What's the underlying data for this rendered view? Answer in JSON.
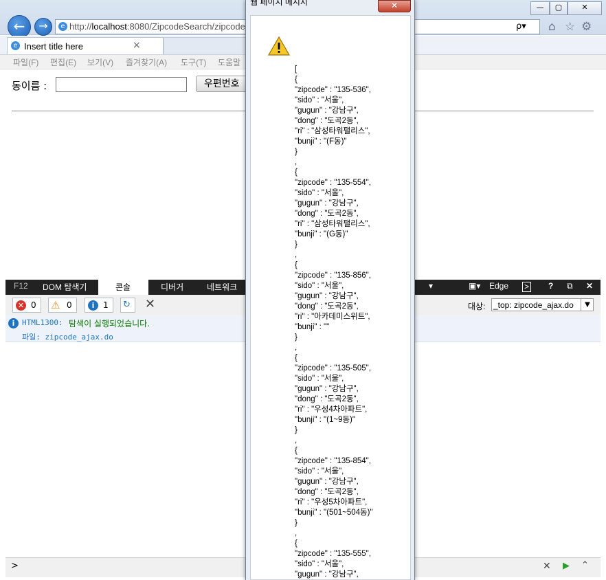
{
  "browser": {
    "address": "http://localhost:8080/ZipcodeSearch/zipcode_",
    "address_host": "localhost",
    "tab_title": "Insert title here",
    "tab_close": "×",
    "menu": [
      "파일(F)",
      "편집(E)",
      "보기(V)",
      "즐겨찾기(A)",
      "도구(T)",
      "도움말"
    ],
    "window_buttons": [
      "—",
      "▢",
      "✕"
    ],
    "search_glyph": "ρ▾"
  },
  "page": {
    "label": "동이름 :",
    "input_value": "",
    "button_label": "우편번호"
  },
  "devtools": {
    "tabs": [
      "F12",
      "DOM 탐색기",
      "콘솔",
      "디버거",
      "네트워크"
    ],
    "active_tab": "콘솔",
    "edge_label": "Edge",
    "error_count": "0",
    "warning_count": "0",
    "info_count": "1",
    "target_label": "대상:",
    "target_value": "_top: zipcode_ajax.do",
    "message_code": "HTML1300:",
    "message_text": "탐색이 실행되었습니다.",
    "message_file": "파일: zipcode_ajax.do",
    "prompt": ">"
  },
  "dialog": {
    "title": "웹 페이지 메시지",
    "close": "✕",
    "message": "[\n{\n\"zipcode\" : \"135-536\",\n\"sido\" : \"서울\",\n\"gugun\" : \"강남구\",\n\"dong\" : \"도곡2동\",\n\"ri\" : \"삼성타워팰리스\",\n\"bunji\" : \"(F동)\"\n}\n,\n{\n\"zipcode\" : \"135-554\",\n\"sido\" : \"서울\",\n\"gugun\" : \"강남구\",\n\"dong\" : \"도곡2동\",\n\"ri\" : \"삼성타워팰리스\",\n\"bunji\" : \"(G동)\"\n}\n,\n{\n\"zipcode\" : \"135-856\",\n\"sido\" : \"서울\",\n\"gugun\" : \"강남구\",\n\"dong\" : \"도곡2동\",\n\"ri\" : \"아카데미스위트\",\n\"bunji\" : \"\"\n}\n,\n{\n\"zipcode\" : \"135-505\",\n\"sido\" : \"서울\",\n\"gugun\" : \"강남구\",\n\"dong\" : \"도곡2동\",\n\"ri\" : \"우성4차아파트\",\n\"bunji\" : \"(1~9동)\"\n}\n,\n{\n\"zipcode\" : \"135-854\",\n\"sido\" : \"서울\",\n\"gugun\" : \"강남구\",\n\"dong\" : \"도곡2동\",\n\"ri\" : \"우성5차아파트\",\n\"bunji\" : \"(501~504동)\"\n}\n,\n{\n\"zipcode\" : \"135-555\",\n\"sido\" : \"서울\",\n\"gugun\" : \"강남구\","
  },
  "colors": {
    "accent": "#1f5fb4",
    "devtools_bar": "#222222",
    "error": "#d9342b",
    "warning": "#e58a12",
    "info": "#1e73be",
    "console_green": "#0a7a00"
  }
}
